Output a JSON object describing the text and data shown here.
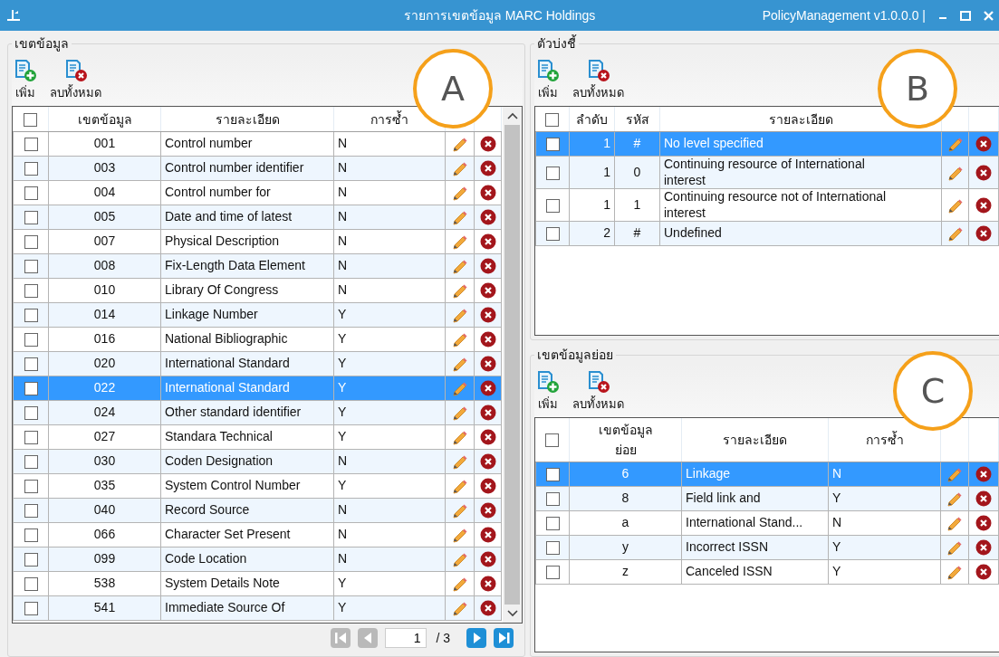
{
  "window": {
    "title": "รายการเขตข้อมูล MARC Holdings",
    "app_version": "PolicyManagement v1.0.0.0 |"
  },
  "fields": {
    "title": "เขตข้อมูล",
    "callout": "A",
    "scrollable": true,
    "all_checked": false,
    "toolbar": [
      {
        "kind": "add",
        "label": "เพิ่ม"
      },
      {
        "kind": "delete_all",
        "label": "ลบทั้งหมด"
      }
    ],
    "columns": [
      {
        "label": "เขตข้อมูล",
        "kind": "code"
      },
      {
        "label": "รายละเอียด",
        "kind": "text"
      },
      {
        "label": "การซ้ำ",
        "kind": "text"
      }
    ],
    "rows": [
      {
        "cells": [
          "001",
          "Control number",
          "N"
        ],
        "selected": false,
        "checked": false
      },
      {
        "cells": [
          "003",
          "Control number identifier",
          "N"
        ],
        "selected": false,
        "checked": false
      },
      {
        "cells": [
          "004",
          "Control number for",
          "N"
        ],
        "selected": false,
        "checked": false
      },
      {
        "cells": [
          "005",
          "Date and time of latest",
          "N"
        ],
        "selected": false,
        "checked": false
      },
      {
        "cells": [
          "007",
          "Physical Description",
          "N"
        ],
        "selected": false,
        "checked": false
      },
      {
        "cells": [
          "008",
          "Fix-Length Data Element",
          "N"
        ],
        "selected": false,
        "checked": false
      },
      {
        "cells": [
          "010",
          "Library Of Congress",
          "N"
        ],
        "selected": false,
        "checked": false
      },
      {
        "cells": [
          "014",
          "Linkage Number",
          "Y"
        ],
        "selected": false,
        "checked": false
      },
      {
        "cells": [
          "016",
          "National Bibliographic",
          "Y"
        ],
        "selected": false,
        "checked": false
      },
      {
        "cells": [
          "020",
          "International Standard",
          "Y"
        ],
        "selected": false,
        "checked": false
      },
      {
        "cells": [
          "022",
          "International  Standard",
          "Y"
        ],
        "selected": true,
        "checked": false
      },
      {
        "cells": [
          "024",
          "Other standard identifier",
          "Y"
        ],
        "selected": false,
        "checked": false
      },
      {
        "cells": [
          "027",
          "Standara Technical",
          "Y"
        ],
        "selected": false,
        "checked": false
      },
      {
        "cells": [
          "030",
          "Coden Designation",
          "N"
        ],
        "selected": false,
        "checked": false
      },
      {
        "cells": [
          "035",
          "System Control Number",
          "Y"
        ],
        "selected": false,
        "checked": false
      },
      {
        "cells": [
          "040",
          "Record Source",
          "N"
        ],
        "selected": false,
        "checked": false
      },
      {
        "cells": [
          "066",
          "Character Set Present",
          "N"
        ],
        "selected": false,
        "checked": false
      },
      {
        "cells": [
          "099",
          "Code Location",
          "N"
        ],
        "selected": false,
        "checked": false
      },
      {
        "cells": [
          "538",
          "System Details Note",
          "Y"
        ],
        "selected": false,
        "checked": false
      },
      {
        "cells": [
          "541",
          "Immediate Source Of",
          "Y"
        ],
        "selected": false,
        "checked": false
      }
    ],
    "pager": {
      "page": "1",
      "total": "/ 3",
      "buttons": [
        {
          "kind": "first",
          "disabled": true
        },
        {
          "kind": "prev",
          "disabled": true
        },
        {
          "kind": "next",
          "disabled": false
        },
        {
          "kind": "last",
          "disabled": false
        }
      ]
    }
  },
  "indicators": {
    "title": "ตัวบ่งชี้",
    "callout": "B",
    "all_checked": false,
    "toolbar": [
      {
        "kind": "add",
        "label": "เพิ่ม"
      },
      {
        "kind": "delete_all",
        "label": "ลบทั้งหมด"
      }
    ],
    "columns": [
      {
        "label": "ลำดับ",
        "kind": "number"
      },
      {
        "label": "รหัส",
        "kind": "code"
      },
      {
        "label": "รายละเอียด",
        "kind": "text"
      }
    ],
    "rows": [
      {
        "cells": [
          "1",
          "#",
          "No level specified"
        ],
        "selected": true,
        "checked": false
      },
      {
        "cells": [
          "1",
          "0",
          "Continuing resource of International interest"
        ],
        "selected": false,
        "checked": false
      },
      {
        "cells": [
          "1",
          "1",
          "Continuing resource not of International interest"
        ],
        "selected": false,
        "checked": false
      },
      {
        "cells": [
          "2",
          "#",
          "Undefined"
        ],
        "selected": false,
        "checked": false
      }
    ]
  },
  "subfields": {
    "title": "เขตข้อมูลย่อย",
    "callout": "C",
    "all_checked": false,
    "toolbar": [
      {
        "kind": "add",
        "label": "เพิ่ม"
      },
      {
        "kind": "delete_all",
        "label": "ลบทั้งหมด"
      }
    ],
    "columns": [
      {
        "label": "เขตข้อมูลย่อย",
        "kind": "code"
      },
      {
        "label": "รายละเอียด",
        "kind": "text"
      },
      {
        "label": "การซ้ำ",
        "kind": "text"
      }
    ],
    "rows": [
      {
        "cells": [
          "6",
          "Linkage",
          "N"
        ],
        "selected": true,
        "checked": false
      },
      {
        "cells": [
          "8",
          "Field link and",
          "Y"
        ],
        "selected": false,
        "checked": false
      },
      {
        "cells": [
          "a",
          "International Stand...",
          "N"
        ],
        "selected": false,
        "checked": false
      },
      {
        "cells": [
          "y",
          "Incorrect ISSN",
          "Y"
        ],
        "selected": false,
        "checked": false
      },
      {
        "cells": [
          "z",
          "Canceled ISSN",
          "Y"
        ],
        "selected": false,
        "checked": false
      }
    ]
  }
}
